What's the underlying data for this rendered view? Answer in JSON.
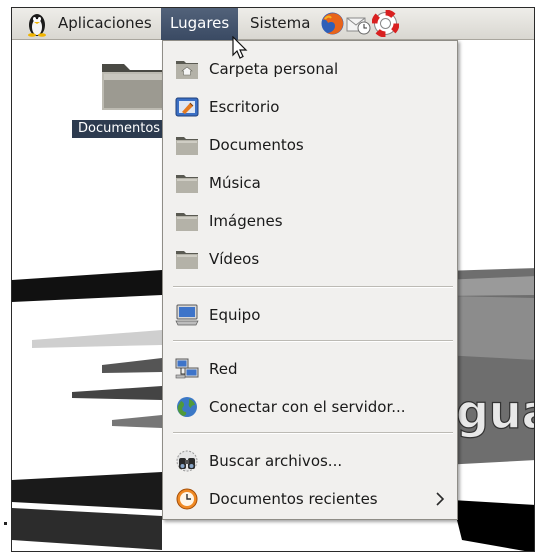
{
  "panel": {
    "logo_icon": "penguin-logo-icon",
    "menus": [
      {
        "label": "Aplicaciones"
      },
      {
        "label": "Lugares",
        "active": true
      },
      {
        "label": "Sistema"
      }
    ],
    "launchers": [
      "firefox-icon",
      "mail-clock-icon",
      "help-lifebuoy-icon"
    ],
    "active_color": "#3f4f68"
  },
  "desktop": {
    "folder_label": "Documentos",
    "wallpaper_text": "gua"
  },
  "menu": {
    "items": [
      {
        "label": "Carpeta personal",
        "icon": "home-folder-icon"
      },
      {
        "label": "Escritorio",
        "icon": "desktop-folder-icon"
      },
      {
        "label": "Documentos",
        "icon": "folder-icon"
      },
      {
        "label": "Música",
        "icon": "folder-icon"
      },
      {
        "label": "Imágenes",
        "icon": "folder-icon"
      },
      {
        "label": "Vídeos",
        "icon": "folder-icon"
      },
      {
        "label": "Equipo",
        "icon": "computer-icon"
      },
      {
        "label": "Red",
        "icon": "network-icon"
      },
      {
        "label": "Conectar con el servidor...",
        "icon": "globe-icon"
      },
      {
        "label": "Buscar archivos...",
        "icon": "search-binoculars-icon"
      },
      {
        "label": "Documentos recientes",
        "icon": "recent-clock-icon",
        "submenu": true
      }
    ]
  }
}
